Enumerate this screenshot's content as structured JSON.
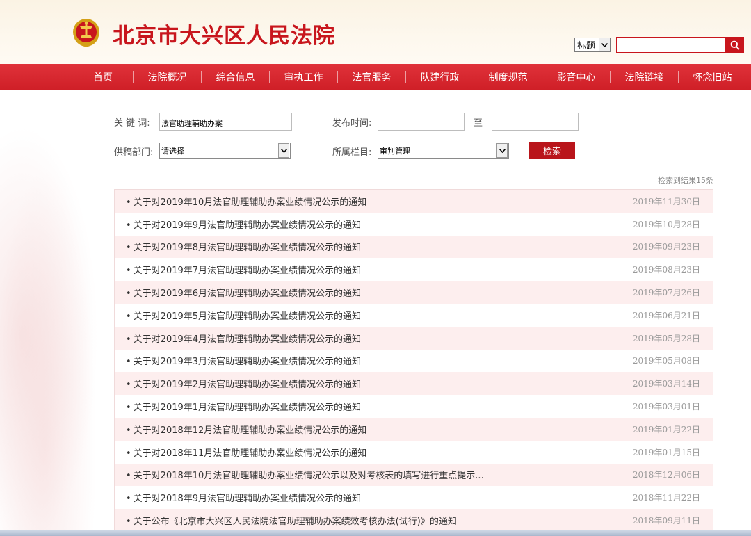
{
  "header": {
    "site_title": "北京市大兴区人民法院",
    "search_field_type": "标题",
    "search_placeholder": ""
  },
  "nav": {
    "items": [
      "首页",
      "法院概况",
      "综合信息",
      "审执工作",
      "法官服务",
      "队建行政",
      "制度规范",
      "影音中心",
      "法院链接",
      "怀念旧站"
    ]
  },
  "filters": {
    "keyword_label": "关 键 词:",
    "keyword_value": "法官助理辅助办案",
    "date_label": "发布时间:",
    "date_to_label": "至",
    "date_from_value": "",
    "date_to_value": "",
    "dept_label": "供稿部门:",
    "dept_value": "请选择",
    "column_label": "所属栏目:",
    "column_value": "审判管理",
    "submit_label": "检索"
  },
  "results": {
    "count_text": "检索到结果15条",
    "items": [
      {
        "title": "关于对2019年10月法官助理辅助办案业绩情况公示的通知",
        "date": "2019年11月30日"
      },
      {
        "title": "关于对2019年9月法官助理辅助办案业绩情况公示的通知",
        "date": "2019年10月28日"
      },
      {
        "title": "关于对2019年8月法官助理辅助办案业绩情况公示的通知",
        "date": "2019年09月23日"
      },
      {
        "title": "关于对2019年7月法官助理辅助办案业绩情况公示的通知",
        "date": "2019年08月23日"
      },
      {
        "title": "关于对2019年6月法官助理辅助办案业绩情况公示的通知",
        "date": "2019年07月26日"
      },
      {
        "title": "关于对2019年5月法官助理辅助办案业绩情况公示的通知",
        "date": "2019年06月21日"
      },
      {
        "title": "关于对2019年4月法官助理辅助办案业绩情况公示的通知",
        "date": "2019年05月28日"
      },
      {
        "title": "关于对2019年3月法官助理辅助办案业绩情况公示的通知",
        "date": "2019年05月08日"
      },
      {
        "title": "关于对2019年2月法官助理辅助办案业绩情况公示的通知",
        "date": "2019年03月14日"
      },
      {
        "title": "关于对2019年1月法官助理辅助办案业绩情况公示的通知",
        "date": "2019年03月01日"
      },
      {
        "title": "关于对2018年12月法官助理辅助办案业绩情况公示的通知",
        "date": "2019年01月22日"
      },
      {
        "title": "关于对2018年11月法官助理辅助办案业绩情况公示的通知",
        "date": "2019年01月15日"
      },
      {
        "title": "关于对2018年10月法官助理辅助办案业绩情况公示以及对考核表的填写进行重点提示...",
        "date": "2018年12月06日"
      },
      {
        "title": "关于对2018年9月法官助理辅助办案业绩情况公示的通知",
        "date": "2018年11月22日"
      },
      {
        "title": "关于公布《北京市大兴区人民法院法官助理辅助办案绩效考核办法(试行)》的通知",
        "date": "2018年09月11日"
      }
    ]
  },
  "colors": {
    "brand_red": "#c8161d",
    "nav_red": "#d9252d",
    "row_tint": "#fdeeee"
  }
}
